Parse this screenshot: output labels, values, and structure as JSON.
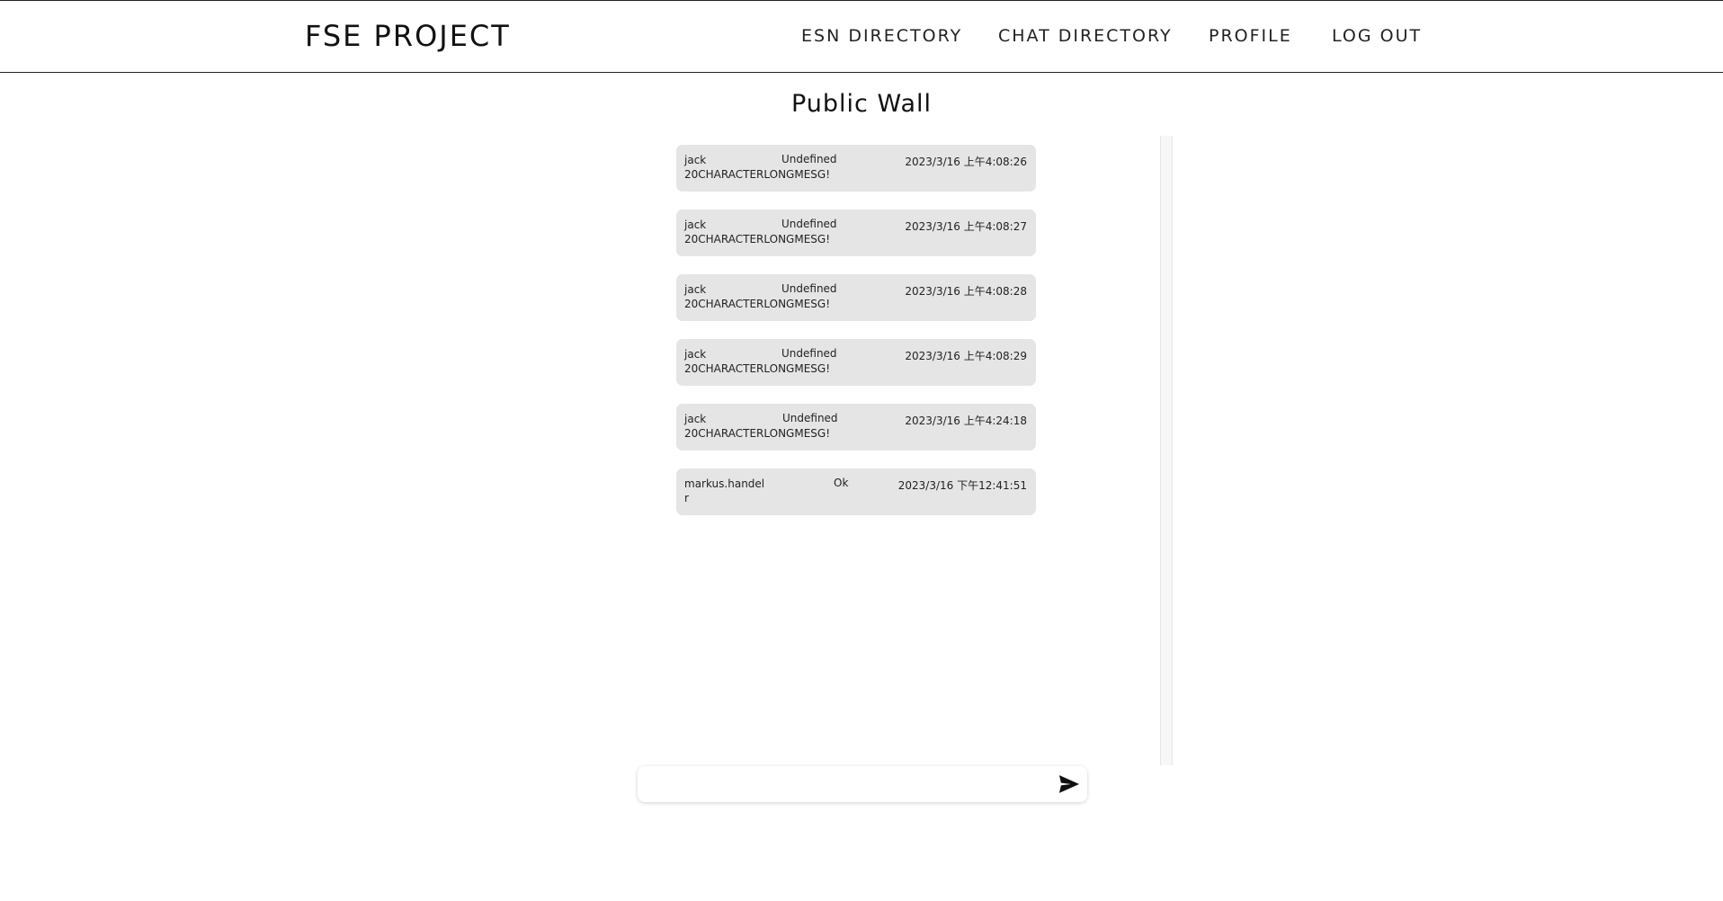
{
  "header": {
    "brand": "FSE PROJECT",
    "nav": [
      {
        "label": "ESN DIRECTORY"
      },
      {
        "label": "CHAT DIRECTORY"
      },
      {
        "label": "PROFILE"
      },
      {
        "label": "LOG OUT"
      }
    ]
  },
  "main": {
    "title": "Public Wall",
    "messages": [
      {
        "user": "jack",
        "status": "Undefined",
        "time": "2023/3/16 上午4:08:26",
        "text": "20CHARACTERLONGMESG!"
      },
      {
        "user": "jack",
        "status": "Undefined",
        "time": "2023/3/16 上午4:08:27",
        "text": "20CHARACTERLONGMESG!"
      },
      {
        "user": "jack",
        "status": "Undefined",
        "time": "2023/3/16 上午4:08:28",
        "text": "20CHARACTERLONGMESG!"
      },
      {
        "user": "jack",
        "status": "Undefined",
        "time": "2023/3/16 上午4:08:29",
        "text": "20CHARACTERLONGMESG!"
      },
      {
        "user": "jack",
        "status": "Undefined",
        "time": "2023/3/16 上午4:24:18",
        "text": "20CHARACTERLONGMESG!"
      },
      {
        "user": "markus.handel r",
        "status": "Ok",
        "time": "2023/3/16 下午12:41:51",
        "text": ""
      }
    ]
  },
  "composer": {
    "input_value": "",
    "placeholder": "",
    "send_icon": "send-icon"
  }
}
